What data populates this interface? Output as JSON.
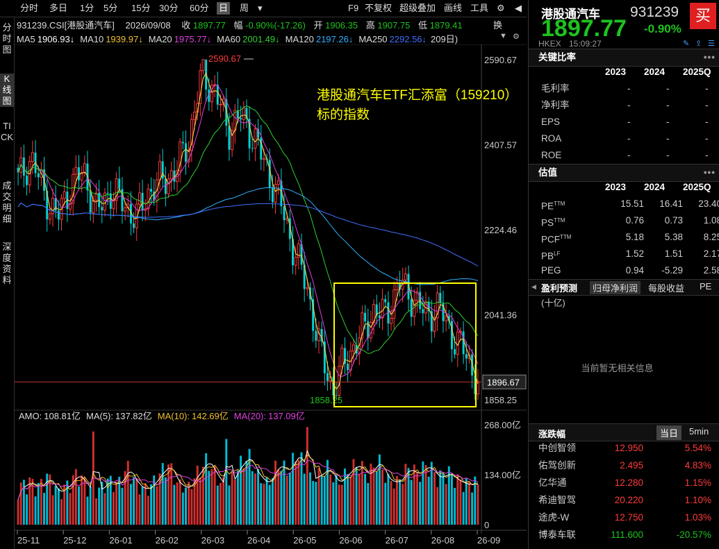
{
  "toolbar": {
    "periods": [
      "分时",
      "多日",
      "1分",
      "5分",
      "15分",
      "30分",
      "60分",
      "日",
      "周"
    ],
    "active_period": "日",
    "dropdown_icon": "▾",
    "right_items": [
      "F9",
      "不复权",
      "超级叠加",
      "画线",
      "工具"
    ],
    "settings_icon": "gear-icon",
    "collapse_icon": "chevron-left-icon"
  },
  "left_tabs": [
    "分时图",
    "K线图",
    "TICK",
    "成交明细",
    "深度资料"
  ],
  "left_tabs_active": "K线图",
  "quote_line": {
    "code_name": "931239.CSI[港股通汽车]",
    "date": "2026/09/08",
    "close_label": "收",
    "close": "1897.77",
    "change_label": "幅",
    "change": "-0.90%(-17.26)",
    "open_label": "开",
    "open": "1906.35",
    "high_label": "高",
    "high": "1907.75",
    "low_label": "低",
    "low": "1879.41",
    "more": "换"
  },
  "ma_line": {
    "items": [
      {
        "label": "MA5",
        "value": "1906.93↓",
        "color": "#ffffff"
      },
      {
        "label": "MA10",
        "value": "1939.97↓",
        "color": "#f0c030"
      },
      {
        "label": "MA20",
        "value": "1975.77↓",
        "color": "#e040e0"
      },
      {
        "label": "MA60",
        "value": "2001.49↓",
        "color": "#30d030"
      },
      {
        "label": "MA120",
        "value": "2197.26↓",
        "color": "#30b0ff"
      },
      {
        "label": "MA250",
        "value": "2292.56↓",
        "color": "#4070ff"
      }
    ],
    "suffix": "209日)"
  },
  "annotation": {
    "line1": "港股通汽车ETF汇添富（159210）",
    "line2": "标的指数",
    "color": "#ffff00"
  },
  "price_axis": {
    "ticks": [
      "2590.67",
      "2407.57",
      "2224.46",
      "2041.36",
      "1858.25"
    ],
    "current_price_tag": "1896.67",
    "max_label": "2590.67",
    "min_label": "1858.25"
  },
  "volume_header": {
    "amo_label": "AMO:",
    "amo": "108.81亿",
    "ma5_label": "MA(5):",
    "ma5": "137.82亿",
    "ma10_label": "MA(10):",
    "ma10": "142.69亿",
    "ma20_label": "MA(20):",
    "ma20": "137.09亿"
  },
  "volume_axis": {
    "ticks": [
      "268.00亿",
      "134.00亿",
      "0"
    ]
  },
  "x_axis": {
    "ticks": [
      "25-11",
      "25-12",
      "26-01",
      "26-02",
      "26-03",
      "26-04",
      "26-05",
      "26-06",
      "26-07",
      "26-08",
      "26-09"
    ]
  },
  "chart_data": [
    {
      "type": "candlestick",
      "title": "931239.CSI 港股通汽车",
      "ylim": [
        1858.25,
        2590.67
      ],
      "x_range": [
        "25-11",
        "26-09"
      ],
      "key_points": {
        "high": 2590.67,
        "low": 1858.25,
        "last_close": 1897.77
      },
      "close_trend_approx": [
        2330,
        2380,
        2300,
        2250,
        2320,
        2350,
        2260,
        2310,
        2280,
        2250,
        2310,
        2330,
        2350,
        2420,
        2560,
        2520,
        2440,
        2470,
        2420,
        2350,
        2280,
        2180,
        2100,
        1960,
        1880,
        1950,
        1990,
        2050,
        2040,
        2110,
        2080,
        2040,
        2060,
        2000,
        1960,
        1897
      ],
      "moving_averages": [
        "MA5",
        "MA10",
        "MA20",
        "MA60",
        "MA120",
        "MA250"
      ]
    },
    {
      "type": "bar",
      "title": "AMO",
      "ylabel": "亿",
      "ylim": [
        0,
        268
      ],
      "values_approx": [
        90,
        110,
        95,
        120,
        80,
        100,
        130,
        90,
        85,
        110,
        100,
        140,
        95,
        88,
        120,
        150,
        100,
        90,
        130,
        160,
        110,
        95,
        140,
        170,
        120,
        100,
        150,
        130,
        180,
        110,
        120,
        140,
        100,
        130,
        150,
        120,
        160,
        110,
        105,
        140,
        125,
        150,
        115,
        130,
        110,
        100,
        108.81
      ]
    }
  ],
  "right_panel": {
    "name": "港股通汽车",
    "code": "931239",
    "buy_button": "买",
    "price": "1897.77",
    "change_pct": "-0.90%",
    "exchange": "HKEX",
    "time": "15:09:27",
    "ratios_title": "关键比率",
    "years": [
      "2023",
      "2024",
      "2025Q"
    ],
    "ratios": [
      {
        "name": "毛利率",
        "v": [
          "-",
          "-",
          "-"
        ]
      },
      {
        "name": "净利率",
        "v": [
          "-",
          "-",
          "-"
        ]
      },
      {
        "name": "EPS",
        "v": [
          "-",
          "-",
          "-"
        ]
      },
      {
        "name": "ROA",
        "v": [
          "-",
          "-",
          "-"
        ]
      },
      {
        "name": "ROE",
        "v": [
          "-",
          "-",
          "-"
        ]
      }
    ],
    "valuation_title": "估值",
    "valuation": [
      {
        "name": "PE",
        "sup": "TTM",
        "v": [
          "15.51",
          "16.41",
          "23.40"
        ]
      },
      {
        "name": "PS",
        "sup": "TTM",
        "v": [
          "0.76",
          "0.73",
          "1.08"
        ]
      },
      {
        "name": "PCF",
        "sup": "TTM",
        "v": [
          "5.18",
          "5.38",
          "8.25"
        ]
      },
      {
        "name": "PB",
        "sup": "LF",
        "v": [
          "1.52",
          "1.51",
          "2.17"
        ]
      },
      {
        "name": "PEG",
        "sup": "",
        "v": [
          "0.94",
          "-5.29",
          "2.58"
        ]
      }
    ],
    "forecast_tabs": [
      "盈利预测",
      "归母净利润",
      "每股收益",
      "PE"
    ],
    "forecast_unit": "(十亿)",
    "forecast_empty": "当前暂无相关信息",
    "movers_title": "涨跌幅",
    "movers_tabs": [
      "当日",
      "5min"
    ],
    "movers": [
      {
        "name": "中创智领",
        "price": "12.950",
        "pct": "5.54%",
        "color": "#ff3b3b"
      },
      {
        "name": "佑驾创新",
        "price": "2.495",
        "pct": "4.83%",
        "color": "#ff3b3b"
      },
      {
        "name": "亿华通",
        "price": "12.280",
        "pct": "1.15%",
        "color": "#ff3b3b"
      },
      {
        "name": "希迪智驾",
        "price": "20.220",
        "pct": "1.10%",
        "color": "#ff3b3b"
      },
      {
        "name": "途虎-W",
        "price": "12.750",
        "pct": "1.03%",
        "color": "#ff3b3b"
      },
      {
        "name": "博泰车联",
        "price": "111.600",
        "pct": "-20.57%",
        "color": "#1ec31e"
      }
    ]
  }
}
